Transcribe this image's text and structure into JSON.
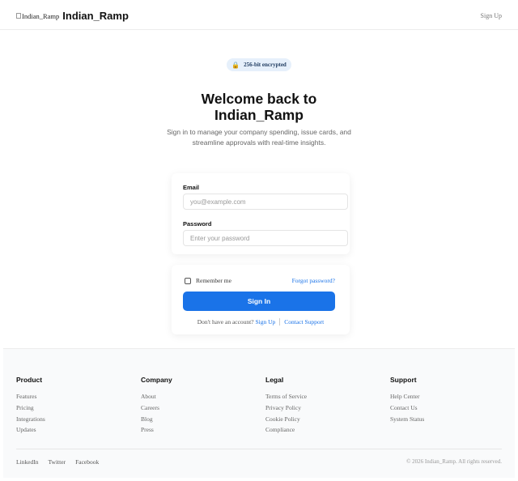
{
  "header": {
    "logo_alt": "Indian_Ramp",
    "brand": "Indian_Ramp",
    "signup": "Sign Up"
  },
  "hero": {
    "badge_icon": "lock-icon",
    "badge": "256-bit encrypted",
    "title_line1": "Welcome back to",
    "title_line2": "Indian_Ramp",
    "subtitle_line1": "Sign in to manage your company spending, issue cards, and",
    "subtitle_line2": "streamline approvals with real-time insights."
  },
  "form": {
    "email_label": "Email",
    "email_placeholder": "you@example.com",
    "password_label": "Password",
    "password_placeholder": "Enter your password",
    "remember": "Remember me",
    "forgot": "Forgot password?",
    "submit": "Sign In",
    "no_account": "Don't have an account?",
    "signup_link": "Sign Up",
    "support_link": "Contact Support"
  },
  "footer": {
    "columns": [
      {
        "title": "Product",
        "links": [
          "Features",
          "Pricing",
          "Integrations",
          "Updates"
        ]
      },
      {
        "title": "Company",
        "links": [
          "About",
          "Careers",
          "Blog",
          "Press"
        ]
      },
      {
        "title": "Legal",
        "links": [
          "Terms of Service",
          "Privacy Policy",
          "Cookie Policy",
          "Compliance"
        ]
      },
      {
        "title": "Support",
        "links": [
          "Help Center",
          "Contact Us",
          "System Status"
        ]
      }
    ],
    "social": [
      "LinkedIn",
      "Twitter",
      "Facebook"
    ],
    "copyright": "© 2026 Indian_Ramp. All rights reserved."
  },
  "colors": {
    "primary": "#1a73e8",
    "badge_bg": "#e6f0fb",
    "footer_bg": "#f9fafb"
  }
}
